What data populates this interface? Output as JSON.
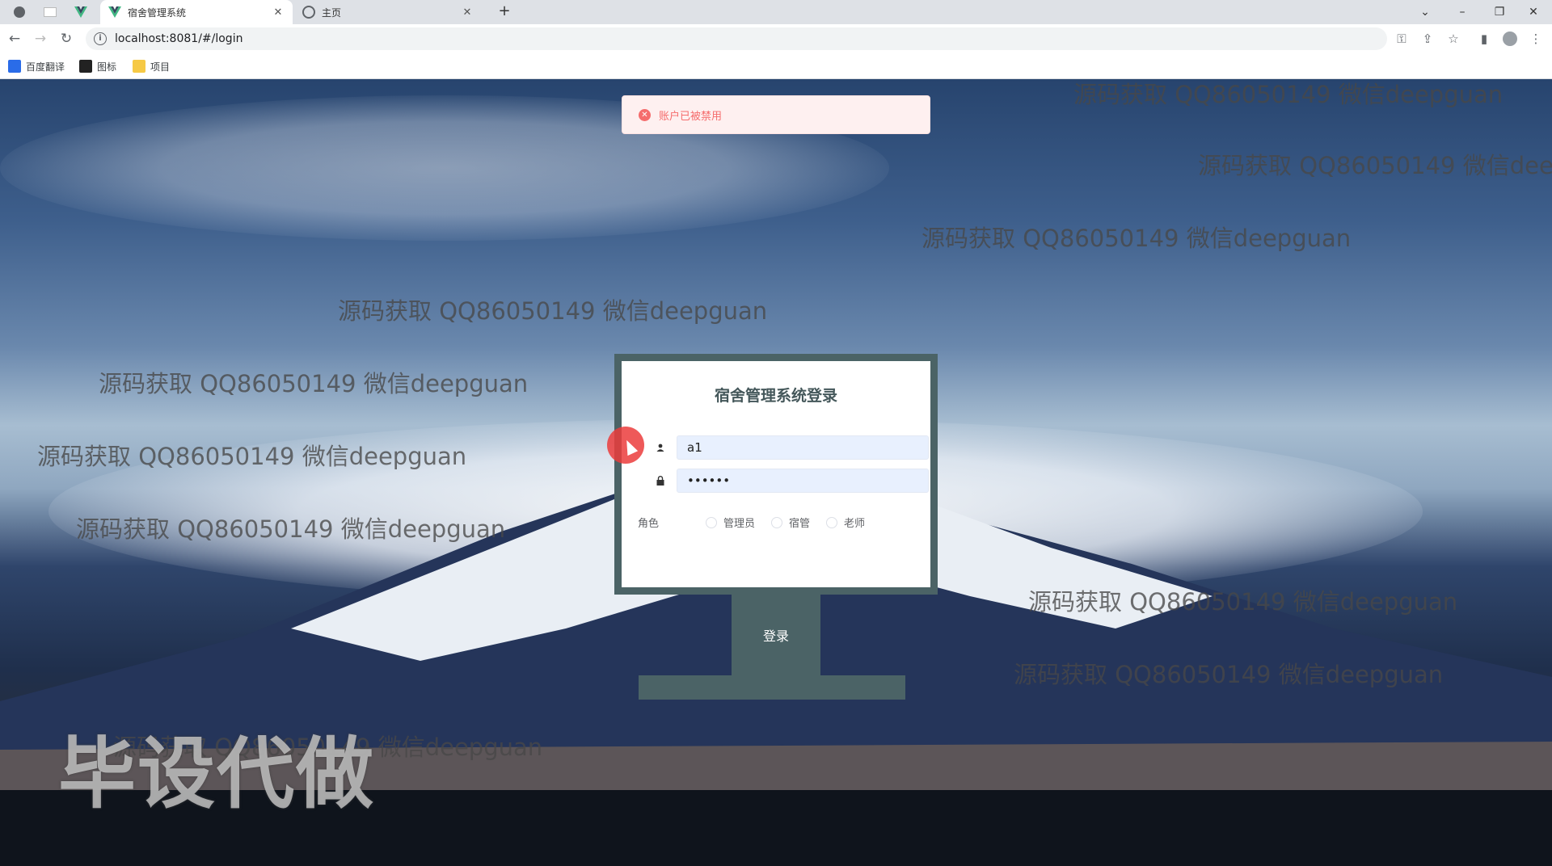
{
  "browser": {
    "tabs": [
      {
        "title": "宿舍管理系统",
        "active": true
      },
      {
        "title": "主页",
        "active": false
      }
    ],
    "new_tab_label": "+",
    "url": "localhost:8081/#/login",
    "bookmarks": [
      {
        "label": "百度翻译",
        "icon": "translate-icon"
      },
      {
        "label": "图标",
        "icon": "image-icon"
      },
      {
        "label": "项目",
        "icon": "folder-icon"
      }
    ],
    "window_controls": {
      "dropdown": "⌄",
      "minimize": "–",
      "restore": "❐",
      "close": "✕"
    }
  },
  "alert": {
    "message": "账户已被禁用",
    "type": "error"
  },
  "login": {
    "title": "宿舍管理系统登录",
    "username_value": "a1",
    "password_value": "••••••",
    "role_label": "角色",
    "roles": [
      "管理员",
      "宿管",
      "老师"
    ],
    "submit_label": "登录"
  },
  "watermarks": {
    "repeat_text": "源码获取 QQ86050149 微信deepguan",
    "big_text": "毕设代做"
  },
  "colors": {
    "panel": "#4b6366",
    "alert_bg": "#fef0f0",
    "alert_text": "#f56c6c",
    "input_bg": "#e8f0fe"
  }
}
